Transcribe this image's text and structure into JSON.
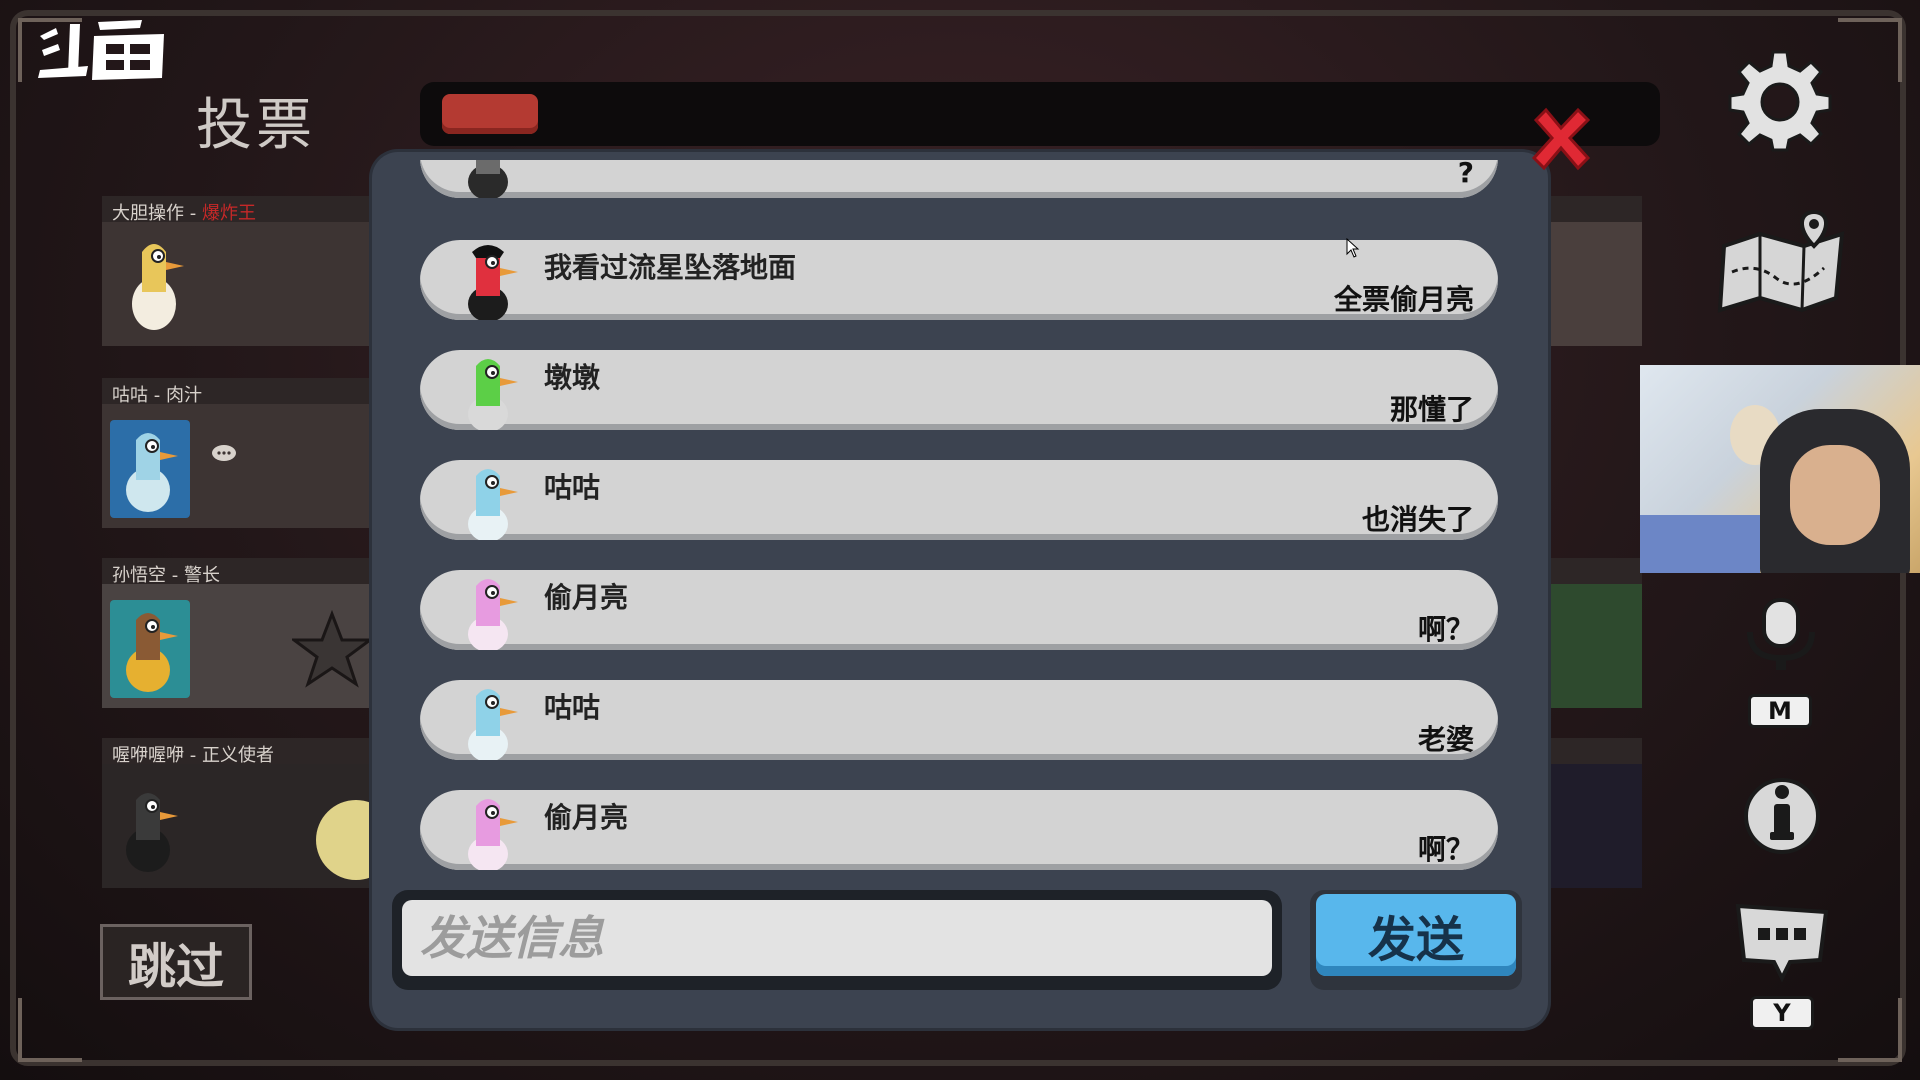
{
  "app": {
    "logo_text": "斗鱼",
    "screen_title": "投票"
  },
  "progress": {
    "fraction": 0.08,
    "color": "#b43a32"
  },
  "players": [
    {
      "name": "大胆操作",
      "role": "爆炸王",
      "role_color": "#c62828"
    },
    {
      "name": "咕咕",
      "role": "肉汁"
    },
    {
      "name": "孙悟空",
      "role": "警长"
    },
    {
      "name": "喔咿喔咿",
      "role": "正义使者"
    }
  ],
  "skip_label": "跳过",
  "chat": {
    "messages": [
      {
        "name": "",
        "text": "?",
        "avatar_color": "#6b6b6b"
      },
      {
        "name": "我看过流星坠落地面",
        "text": "全票偷月亮",
        "avatar_color": "#e0303e"
      },
      {
        "name": "墩墩",
        "text": "那懂了",
        "avatar_color": "#5ccf47"
      },
      {
        "name": "咕咕",
        "text": "也消失了",
        "avatar_color": "#8fd2e8"
      },
      {
        "name": "偷月亮",
        "text": "啊？",
        "avatar_color": "#e79be0"
      },
      {
        "name": "咕咕",
        "text": "老婆",
        "avatar_color": "#8fd2e8"
      },
      {
        "name": "偷月亮",
        "text": "啊？",
        "avatar_color": "#e79be0"
      }
    ],
    "input_placeholder": "发送信息",
    "send_label": "发送"
  },
  "sidebar": {
    "mic_key": "M",
    "chat_key": "Y"
  },
  "colors": {
    "send_button": "#58b7ec",
    "close_x": "#e02934"
  }
}
